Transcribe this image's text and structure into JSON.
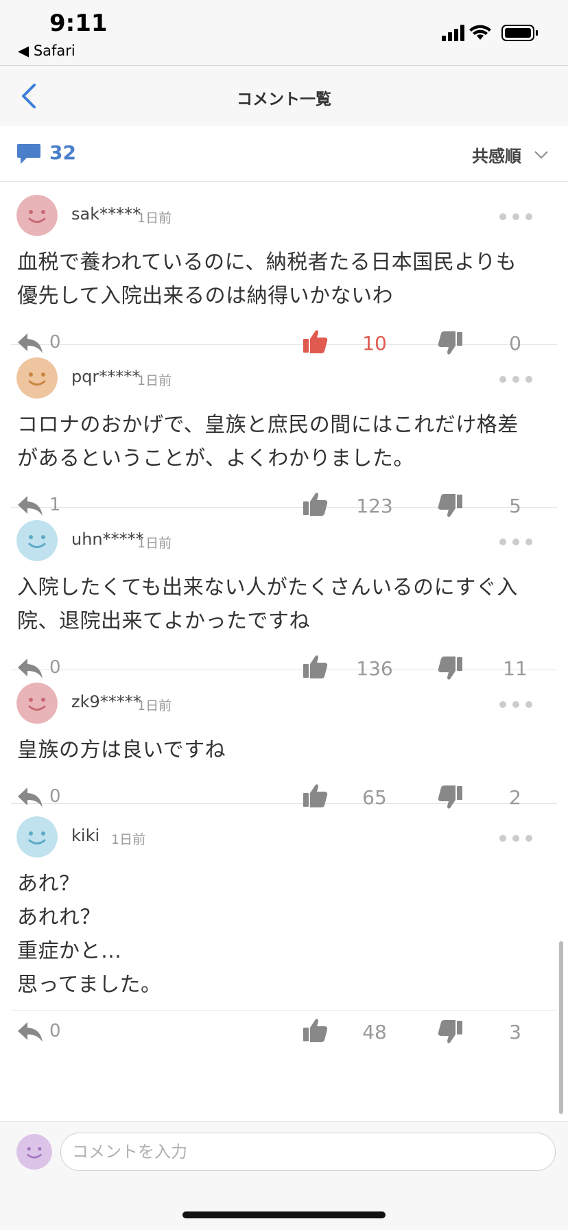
{
  "status_bar": {
    "time": "9:11",
    "back_app": "◀ Safari"
  },
  "nav": {
    "title": "コメント一覧"
  },
  "summary": {
    "comment_count": "32",
    "sort_label": "共感順"
  },
  "comments": [
    {
      "user": "sak*****",
      "ago": "1日前",
      "text": "血税で養われているのに、納税者たる日本国民よりも\n優先して入院出来るのは納得いかないわ",
      "replies": "0",
      "likes": "10",
      "dislikes": "0",
      "avatar_color": "#e8b4b8",
      "face_color": "#c76a72",
      "liked": true
    },
    {
      "user": "pqr*****",
      "ago": "1日前",
      "text": "コロナのおかげで、皇族と庶民の間にはこれだけ格差\nがあるということが、よくわかりました。",
      "replies": "1",
      "likes": "123",
      "dislikes": "5",
      "avatar_color": "#eec59f",
      "face_color": "#c8853f",
      "liked": false
    },
    {
      "user": "uhn*****",
      "ago": "1日前",
      "text": "入院したくても出来ない人がたくさんいるのにすぐ入\n院、退院出来てよかったですね",
      "replies": "0",
      "likes": "136",
      "dislikes": "11",
      "avatar_color": "#bfe2ee",
      "face_color": "#5ea9c4",
      "liked": false
    },
    {
      "user": "zk9*****",
      "ago": "1日前",
      "text": "皇族の方は良いですね",
      "replies": "0",
      "likes": "65",
      "dislikes": "2",
      "avatar_color": "#e8b4b8",
      "face_color": "#c76a72",
      "liked": false
    },
    {
      "user": "kiki",
      "ago": "1日前",
      "text": "あれ？\nあれれ？\n重症かと…\n思ってました。",
      "replies": "0",
      "likes": "48",
      "dislikes": "3",
      "avatar_color": "#bfe2ee",
      "face_color": "#5ea9c4",
      "liked": false
    }
  ],
  "footer": {
    "placeholder": "コメントを入力",
    "avatar_color": "#dcc3e8",
    "face_color": "#a274c0"
  },
  "colors": {
    "accent": "#4a7fc9",
    "like_active": "#e05a4f",
    "icon_gray": "#888888"
  }
}
